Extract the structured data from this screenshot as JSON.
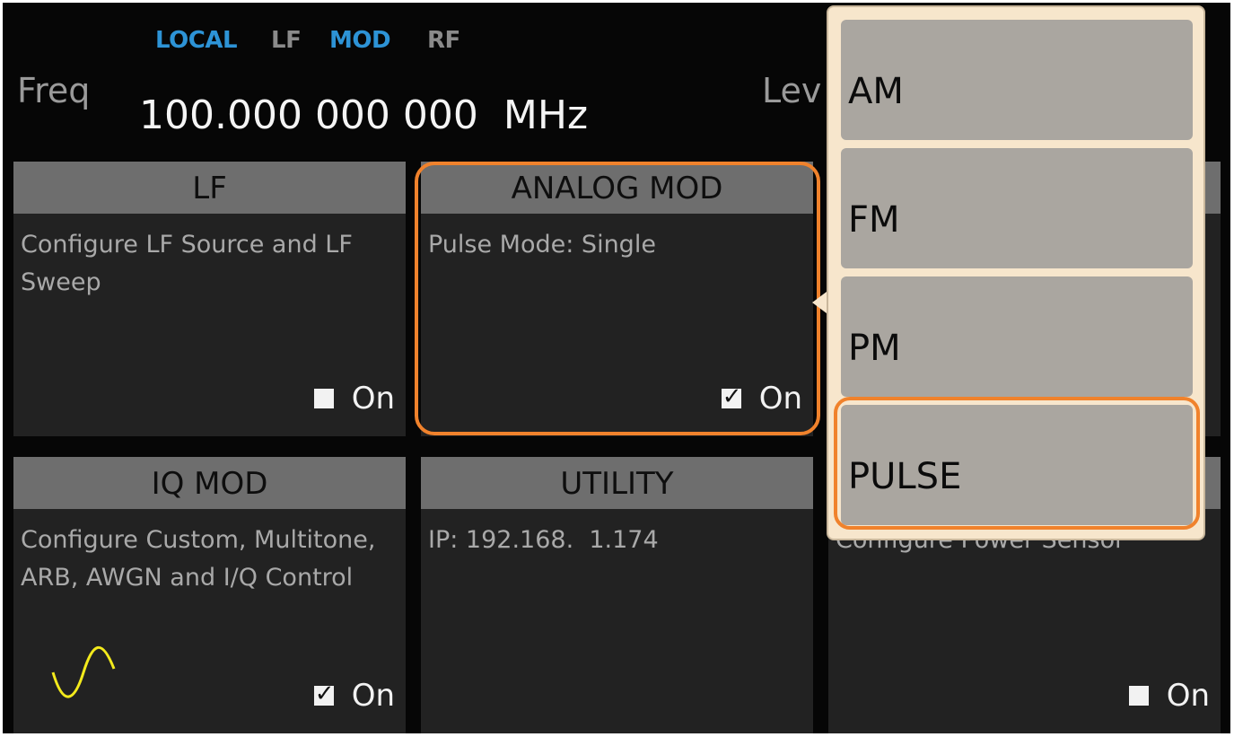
{
  "status_bar": {
    "local": "LOCAL",
    "lf": "LF",
    "mod": "MOD",
    "rf": "RF"
  },
  "frequency": {
    "label": "Freq",
    "value": "100.000 000 000",
    "unit": "MHz"
  },
  "level": {
    "label": "Lev"
  },
  "tiles": {
    "lf": {
      "title": "LF",
      "description": "Configure LF Source and LF Sweep",
      "toggle_label": "On",
      "checked": false
    },
    "analog_mod": {
      "title": "ANALOG MOD",
      "description": "Pulse Mode: Single",
      "toggle_label": "On",
      "checked": true
    },
    "iq_mod": {
      "title": "IQ MOD",
      "description": "Configure Custom, Multitone, ARB, AWGN and I/Q Control",
      "toggle_label": "On",
      "checked": true,
      "icon": "sine-wave-icon"
    },
    "utility": {
      "title": "UTILITY",
      "description": "IP: 192.168.  1.174"
    },
    "power_sensor": {
      "description": "Configure Power Sensor",
      "toggle_label": "On",
      "checked": false
    }
  },
  "popup_menu": {
    "items": [
      {
        "label": "AM"
      },
      {
        "label": "FM"
      },
      {
        "label": "PM"
      },
      {
        "label": "PULSE",
        "highlighted": true
      }
    ]
  },
  "colors": {
    "highlight": "#f0822c",
    "status_active": "#2d93d6",
    "status_inactive": "#8a8a8a",
    "tile_header": "#6e6e6e",
    "tile_body": "#222222",
    "popup_bg": "#f7e6cc",
    "menu_item": "#aaa6a0",
    "sine_wave": "#f3ea1c"
  }
}
